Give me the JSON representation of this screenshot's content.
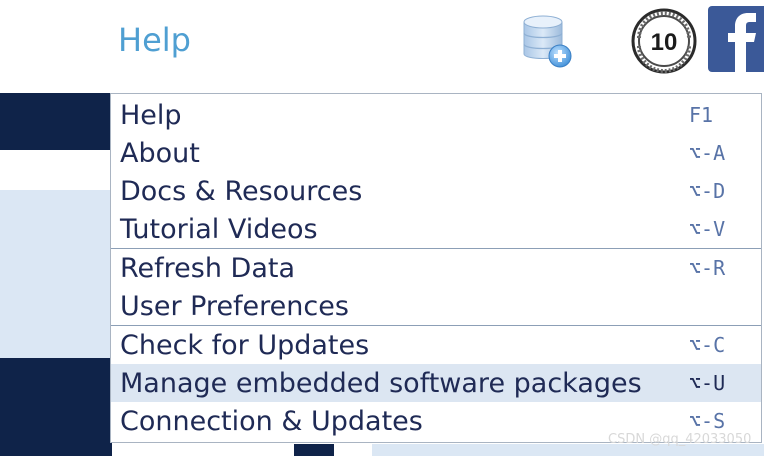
{
  "menubar": {
    "title": "Help"
  },
  "toolbar": {
    "icons": [
      "database-add-icon",
      "ten-year-badge-icon",
      "facebook-icon"
    ],
    "badge_text": "10"
  },
  "dropdown": {
    "groups": [
      {
        "items": [
          {
            "label": "Help",
            "shortcut": "F1"
          },
          {
            "label": "About",
            "shortcut": "⌥-A"
          },
          {
            "label": "Docs & Resources",
            "shortcut": "⌥-D"
          },
          {
            "label": "Tutorial Videos",
            "shortcut": "⌥-V"
          }
        ]
      },
      {
        "items": [
          {
            "label": "Refresh Data",
            "shortcut": "⌥-R"
          },
          {
            "label": "User Preferences",
            "shortcut": ""
          }
        ]
      },
      {
        "items": [
          {
            "label": "Check for Updates",
            "shortcut": "⌥-C"
          },
          {
            "label": "Manage embedded software packages",
            "shortcut": "⌥-U",
            "highlighted": true
          },
          {
            "label": "Connection & Updates",
            "shortcut": "⌥-S"
          }
        ]
      }
    ]
  },
  "watermark": "CSDN @qq_42033050",
  "colors": {
    "title": "#4f9fd2",
    "menu_text": "#1f2a55",
    "shortcut_text": "#5873a7",
    "highlight": "#dce6f2",
    "navy": "#0f2349",
    "facebook": "#3b5998"
  }
}
